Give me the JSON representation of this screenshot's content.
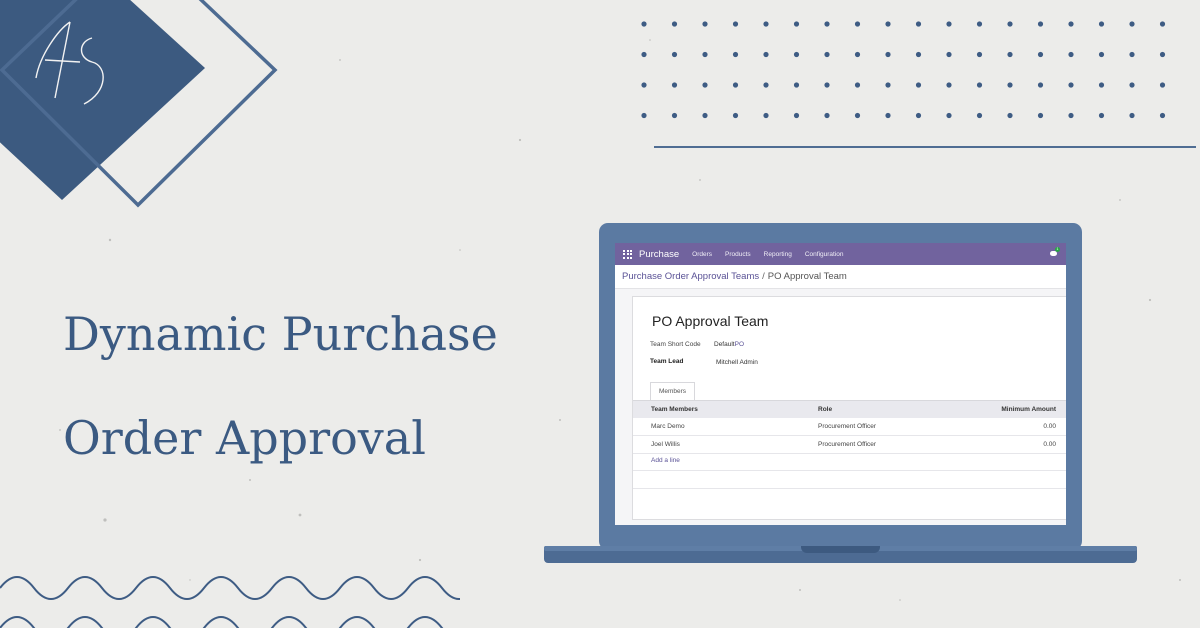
{
  "headline": {
    "line1": "Dynamic Purchase",
    "line2": "Order Approval"
  },
  "colors": {
    "background": "#ececea",
    "accent_blue": "#3b5a82",
    "odoo_purple": "#71639e",
    "link_purple": "#5a5296"
  },
  "app": {
    "name": "Purchase",
    "menu": [
      "Orders",
      "Products",
      "Reporting",
      "Configuration"
    ],
    "chat_badge": "1"
  },
  "breadcrumb": {
    "parent": "Purchase Order Approval Teams",
    "separator": "/",
    "current": "PO Approval Team"
  },
  "form": {
    "title": "PO Approval Team",
    "short_code_label": "Team Short Code",
    "short_code_prefix": "Default",
    "short_code_value": "PO",
    "team_lead_label": "Team Lead",
    "team_lead_value": "Mitchell Admin",
    "tab_label": "Members",
    "table": {
      "headers": [
        "Team Members",
        "Role",
        "Minimum Amount"
      ],
      "rows": [
        [
          "Marc Demo",
          "Procurement Officer",
          "0.00"
        ],
        [
          "Joel Willis",
          "Procurement Officer",
          "0.00"
        ]
      ],
      "add_line": "Add a line"
    }
  }
}
